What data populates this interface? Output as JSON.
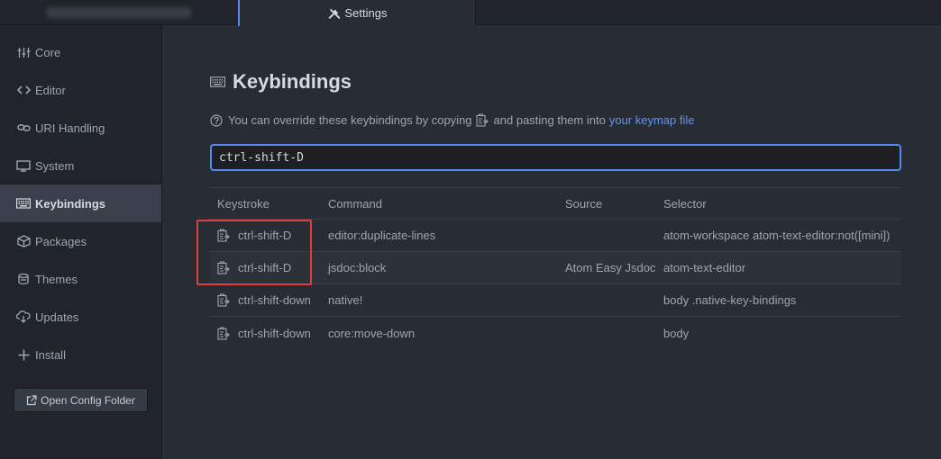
{
  "tabs": {
    "inactive_label": "",
    "active_label": "Settings"
  },
  "sidebar": {
    "items": [
      {
        "label": "Core",
        "icon": "sliders-icon"
      },
      {
        "label": "Editor",
        "icon": "code-icon"
      },
      {
        "label": "URI Handling",
        "icon": "link-icon"
      },
      {
        "label": "System",
        "icon": "monitor-icon"
      },
      {
        "label": "Keybindings",
        "icon": "keyboard-icon",
        "selected": true
      },
      {
        "label": "Packages",
        "icon": "package-icon"
      },
      {
        "label": "Themes",
        "icon": "paintcan-icon"
      },
      {
        "label": "Updates",
        "icon": "cloud-download-icon"
      },
      {
        "label": "Install",
        "icon": "plus-icon"
      }
    ],
    "open_config_label": "Open Config Folder"
  },
  "main": {
    "title": "Keybindings",
    "hint_before": "You can override these keybindings by copying",
    "hint_after": "and pasting them into",
    "hint_link": "your keymap file",
    "search_value": "ctrl-shift-D"
  },
  "table": {
    "headers": {
      "keystroke": "Keystroke",
      "command": "Command",
      "source": "Source",
      "selector": "Selector"
    },
    "rows": [
      {
        "keystroke": "ctrl-shift-D",
        "command": "editor:duplicate-lines",
        "source": "",
        "selector": "atom-workspace atom-text-editor:not([mini])"
      },
      {
        "keystroke": "ctrl-shift-D",
        "command": "jsdoc:block",
        "source": "Atom Easy Jsdoc",
        "selector": "atom-text-editor"
      },
      {
        "keystroke": "ctrl-shift-down",
        "command": "native!",
        "source": "",
        "selector": "body .native-key-bindings"
      },
      {
        "keystroke": "ctrl-shift-down",
        "command": "core:move-down",
        "source": "",
        "selector": "body"
      }
    ]
  },
  "colors": {
    "accent": "#568af2",
    "link": "#6494ed",
    "highlight_box": "#e0403a",
    "background": "#282c34",
    "sidebar_background": "#21252b"
  }
}
